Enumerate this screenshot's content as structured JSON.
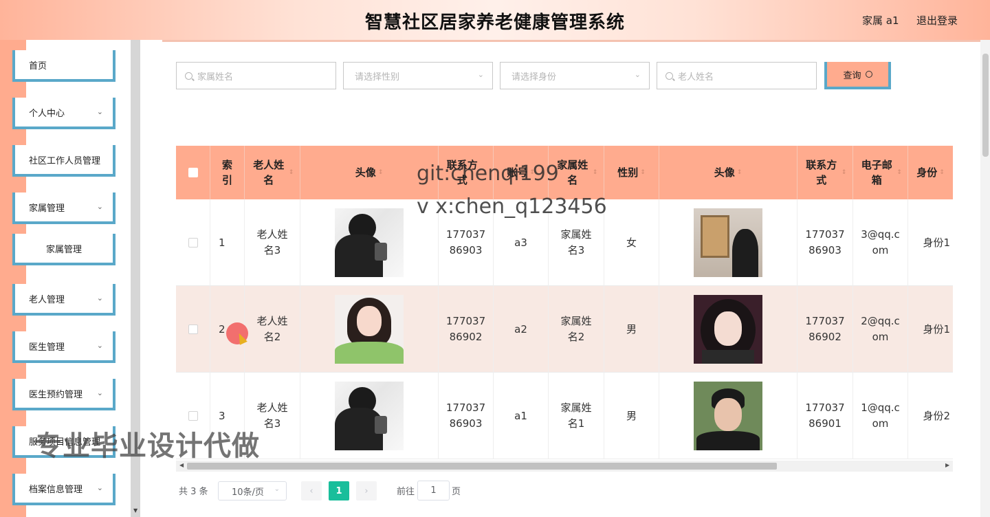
{
  "header": {
    "title": "智慧社区居家养老健康管理系统",
    "user": "家属 a1",
    "logout": "退出登录"
  },
  "sidebar": {
    "items": [
      {
        "label": "首页",
        "has_arrow": false
      },
      {
        "label": "个人中心",
        "has_arrow": true
      },
      {
        "label": "社区工作人员管理",
        "has_arrow": false
      },
      {
        "label": "家属管理",
        "has_arrow": true
      },
      {
        "label": "家属管理",
        "has_arrow": false,
        "sub": true
      },
      {
        "label": "老人管理",
        "has_arrow": true
      },
      {
        "label": "医生管理",
        "has_arrow": true
      },
      {
        "label": "医生预约管理",
        "has_arrow": true
      },
      {
        "label": "服务项目信息管理",
        "has_arrow": false
      },
      {
        "label": "档案信息管理",
        "has_arrow": true
      }
    ]
  },
  "search": {
    "family_name_placeholder": "家属姓名",
    "gender_placeholder": "请选择性别",
    "identity_placeholder": "请选择身份",
    "elder_name_placeholder": "老人姓名",
    "button_label": "查询"
  },
  "table": {
    "headers": [
      "索引",
      "老人姓名",
      "头像",
      "联系方式",
      "账号",
      "家属姓名",
      "性别",
      "头像",
      "联系方式",
      "电子邮箱",
      "身份"
    ],
    "rows": [
      {
        "index": "1",
        "elder_name": "老人姓名3",
        "elder_avatar": "man-dark-avatar",
        "elder_phone": "17703786903",
        "account": "a3",
        "family_name": "家属姓名3",
        "gender": "女",
        "family_avatar": "man-gallery-avatar",
        "family_phone": "17703786903",
        "email": "3@qq.com",
        "identity": "身份1"
      },
      {
        "index": "2",
        "elder_name": "老人姓名2",
        "elder_avatar": "girl-green-avatar",
        "elder_phone": "17703786902",
        "account": "a2",
        "family_name": "家属姓名2",
        "gender": "男",
        "family_avatar": "girl-dark-avatar",
        "family_phone": "17703786902",
        "email": "2@qq.com",
        "identity": "身份1"
      },
      {
        "index": "3",
        "elder_name": "老人姓名3",
        "elder_avatar": "man-dark-avatar",
        "elder_phone": "17703786903",
        "account": "a1",
        "family_name": "家属姓名1",
        "gender": "男",
        "family_avatar": "man-portrait-avatar",
        "family_phone": "17703786901",
        "email": "1@qq.com",
        "identity": "身份2"
      }
    ]
  },
  "pagination": {
    "total": "共 3 条",
    "page_size": "10条/页",
    "current_page": "1",
    "goto_label": "前往",
    "goto_value": "1",
    "page_suffix": "页"
  },
  "overlays": {
    "watermark_line1": "git:chenqi199",
    "watermark_line2": "v x:chen_q123456",
    "banner": "专业毕业设计代做"
  },
  "colors": {
    "accent": "#ffab8e",
    "border_blue": "#5aa8c9",
    "active_page": "#19be9b"
  }
}
